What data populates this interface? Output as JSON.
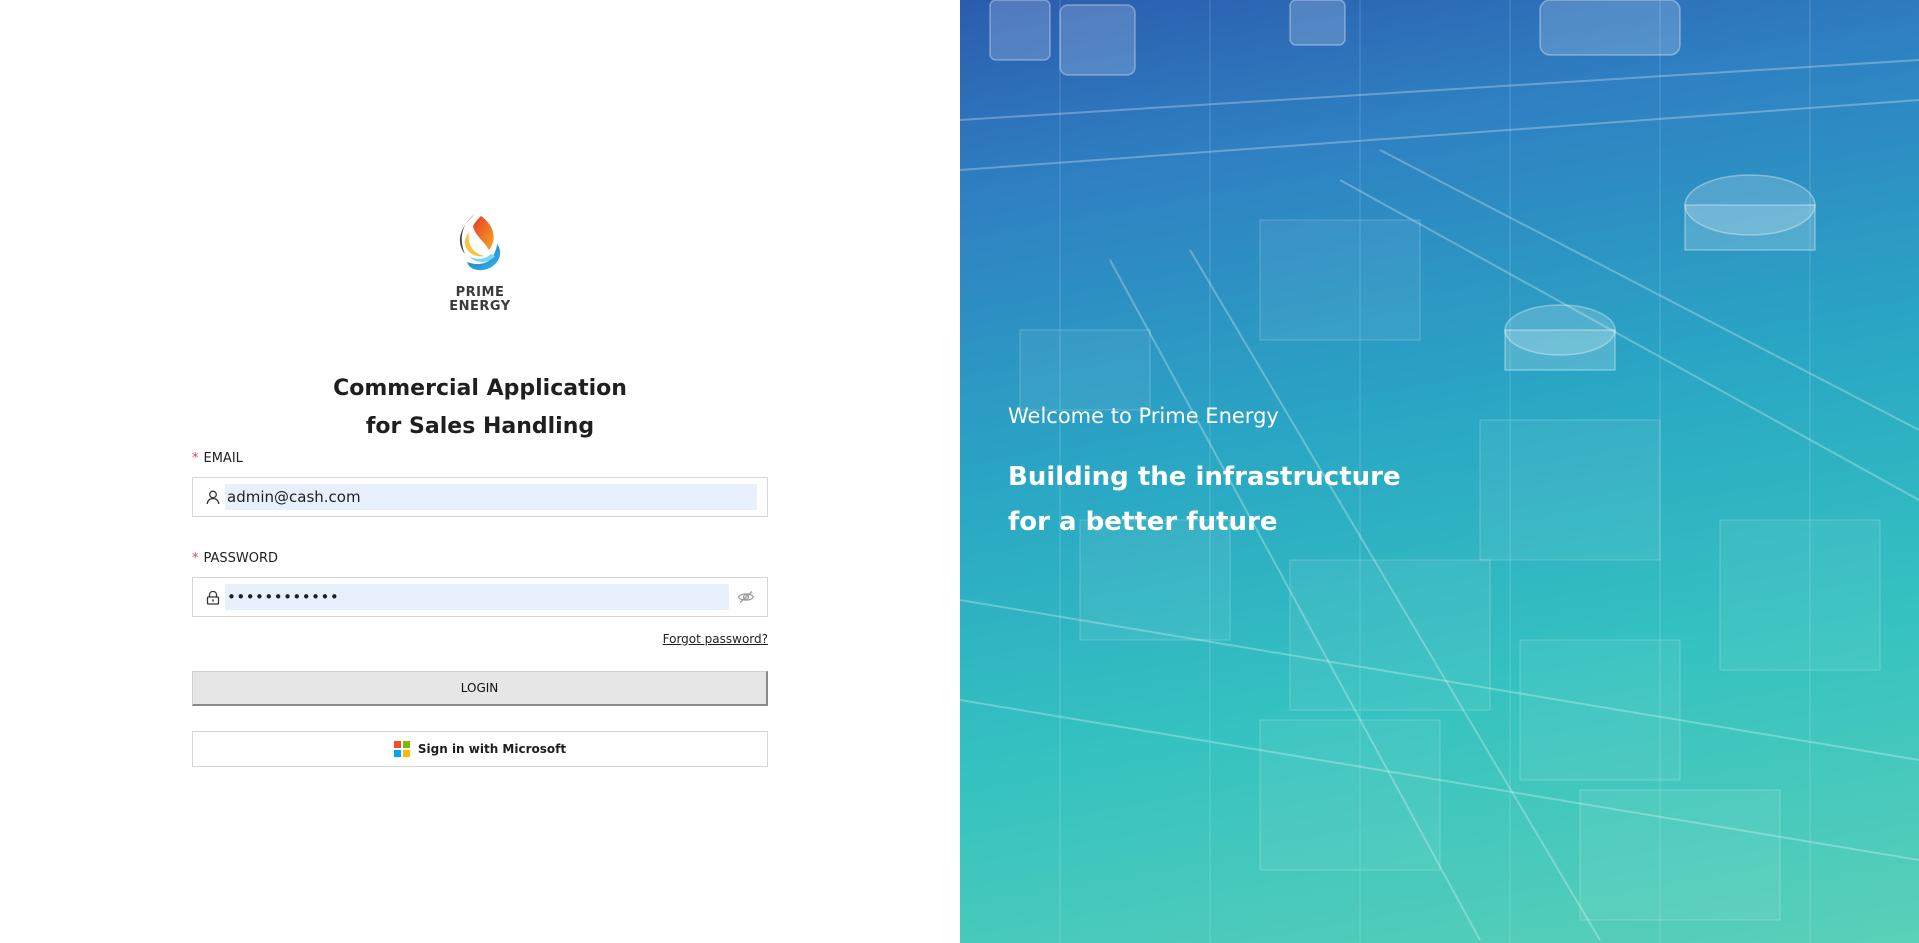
{
  "brand": {
    "name_line1": "PRIME",
    "name_line2": "ENERGY"
  },
  "app_title": {
    "line1": "Commercial Application",
    "line2": "for Sales Handling"
  },
  "form": {
    "required_marker": "*",
    "email_label": "EMAIL",
    "email_value": "admin@cash.com",
    "password_label": "PASSWORD",
    "password_value": "••••••••••••",
    "forgot_password": "Forgot password?",
    "login_button": "LOGIN",
    "microsoft_button": "Sign in with Microsoft"
  },
  "hero": {
    "welcome": "Welcome to Prime Energy",
    "headline_line1": "Building the infrastructure",
    "headline_line2": "for a better future"
  },
  "icons": {
    "email_field": "user-icon",
    "password_field": "lock-icon",
    "password_toggle": "eye-off-icon",
    "microsoft": "microsoft-logo-icon"
  },
  "colors": {
    "required": "#e5484d",
    "autofill_bg": "#e8f0fe",
    "login_bg": "#e6e6e6",
    "hero_top": "#2b5cae",
    "hero_bottom": "#5ad0b8",
    "ms_red": "#f25022",
    "ms_green": "#7fba00",
    "ms_blue": "#00a4ef",
    "ms_yellow": "#ffb900"
  }
}
